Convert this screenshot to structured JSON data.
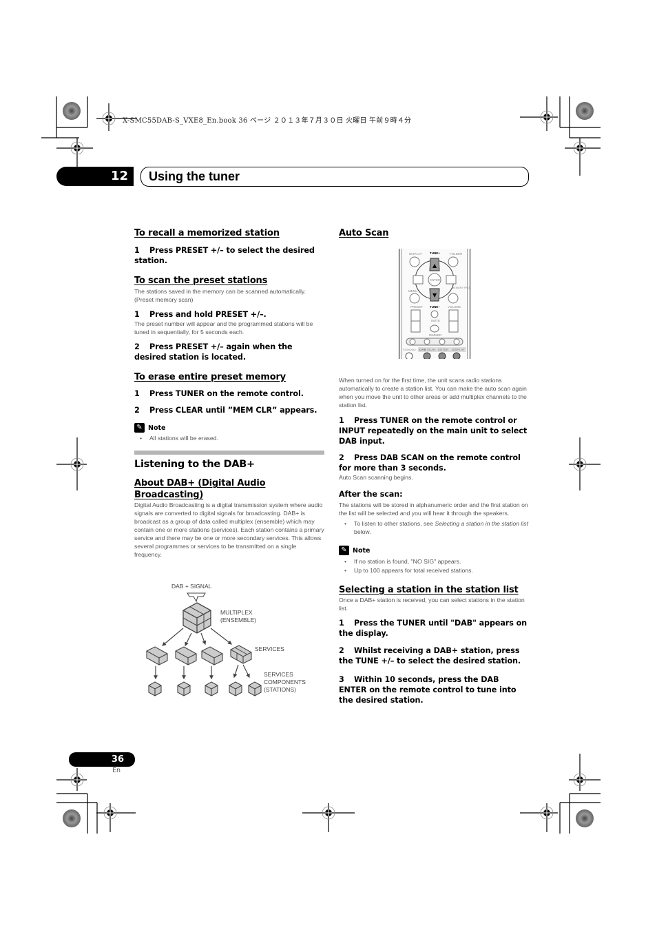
{
  "print_header": {
    "book_line": "X-SMC55DAB-S_VXE8_En.book   36 ページ   ２０１３年７月３０日   火曜日   午前９時４分"
  },
  "chapter": {
    "number": "12",
    "title": "Using the tuner"
  },
  "left_column": {
    "recall": {
      "heading": "To recall a memorized station",
      "steps": [
        {
          "num": "1",
          "text": "Press PRESET +/– to select the desired station."
        }
      ]
    },
    "scan_preset": {
      "heading": "To scan the preset stations",
      "intro": "The stations saved in the memory can be scanned automatically. (Preset memory scan)",
      "steps": [
        {
          "num": "1",
          "text": "Press and hold PRESET +/–.",
          "detail": "The preset number will appear and the programmed stations will be tuned in sequentially, for 5 seconds each."
        },
        {
          "num": "2",
          "text": "Press PRESET +/– again when the desired station is located."
        }
      ]
    },
    "erase": {
      "heading": "To erase entire preset memory",
      "steps": [
        {
          "num": "1",
          "text": "Press TUNER on the remote control."
        },
        {
          "num": "2",
          "text": "Press CLEAR until ”MEM CLR” appears."
        }
      ],
      "note_label": "Note",
      "note_items": [
        "All stations will be erased."
      ]
    },
    "dab_section": {
      "heading": "Listening to the DAB+",
      "about_heading": "About DAB+ (Digital Audio Broadcasting)",
      "about_text": "Digital Audio Broadcasting is a digital transmission system where audio signals are converted to digital signals for broadcasting. DAB+ is broadcast as a group of data called multiplex (ensemble) which may contain one or more stations (services). Each station contains a primary service and there may be one or more secondary services. This allows several programmes or services to be transmitted on a single frequency."
    },
    "diagram": {
      "signal_label": "DAB + SIGNAL",
      "multiplex_label_1": "MULTIPLEX",
      "multiplex_label_2": "(ENSEMBLE)",
      "services_label": "SERVICES",
      "components_label_1": "SERVICES",
      "components_label_2": "COMPONENTS",
      "components_label_3": "(STATIONS)"
    }
  },
  "right_column": {
    "auto_scan": {
      "heading": "Auto Scan",
      "remote": {
        "display": "DISPLAY",
        "tune_plus": "TUNE+",
        "folder": "FOLDER",
        "enter": "ENTER",
        "menu": "MENU",
        "memory_program": "MEMORY PROGRAM",
        "preset": "PRESET",
        "tune_minus": "TUNE–",
        "volume": "VOLUME",
        "mute": "MUTE",
        "dimmer": "DIMMER",
        "st_mono": "ST/MONO",
        "dab": "DAB",
        "scan": "SCAN",
        "dab_enter": "ENTER",
        "dab_display": "DISPLAY"
      },
      "intro": "When turned on for the first time, the unit scans radio stations automatically to create a station list. You can make the auto scan again when you move the unit to other areas or add multiplex channels to the station list.",
      "steps": [
        {
          "num": "1",
          "text": "Press TUNER on the remote control or INPUT repeatedly on the main unit to select DAB input."
        },
        {
          "num": "2",
          "text": "Press DAB SCAN on the remote control for more than 3 seconds.",
          "detail": "Auto Scan scanning begins."
        }
      ],
      "after_heading": "After the scan:",
      "after_text": "The stations will be stored in alphanumeric order and the first station on the list will be selected and you will hear it through the speakers.",
      "after_bullet_prefix": "To listen to other stations, see ",
      "after_bullet_link": "Selecting a station in the station list",
      "after_bullet_suffix": " below.",
      "note_label": "Note",
      "note_items": [
        "If no station is found, \"NO SIG\" appears.",
        "Up to 100 appears for total received stations."
      ]
    },
    "select_station": {
      "heading": "Selecting a station in the station list",
      "intro": "Once a DAB+ station is received, you can select stations in the station list.",
      "steps": [
        {
          "num": "1",
          "text": "Press the TUNER until \"DAB\" appears on the display."
        },
        {
          "num": "2",
          "text": "Whilst receiving a DAB+ station, press the TUNE +/– to select the desired station."
        },
        {
          "num": "3",
          "text": "Within 10 seconds, press the DAB ENTER on the remote control to tune into the desired station."
        }
      ]
    }
  },
  "footer": {
    "page_number": "36",
    "language": "En"
  }
}
